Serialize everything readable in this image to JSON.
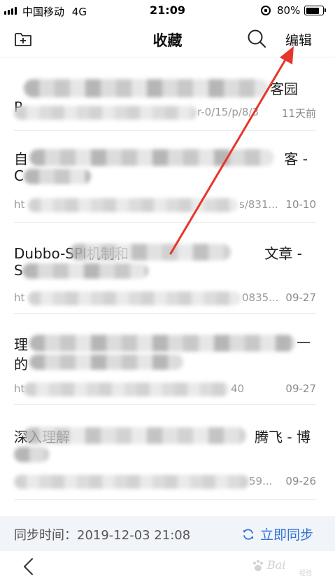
{
  "status_bar": {
    "carrier": "中国移动",
    "network": "4G",
    "time": "21:09",
    "battery": "80%",
    "battery_level": 0.8
  },
  "nav": {
    "title": "收藏",
    "edit_label": "编辑",
    "icons": [
      "add-folder-icon",
      "search-icon"
    ]
  },
  "favorites": [
    {
      "title": "P",
      "title_end": "客园",
      "url_start": "",
      "url_end": "r-0/15/p/8/3",
      "date": "11天前"
    },
    {
      "title_line1_start": "自",
      "title_line1_end": "客 -",
      "title_line2": "C",
      "url_start": "ht",
      "url_end": "s/831...",
      "date": "10-10"
    },
    {
      "title_line1_start": "Dubbo-SPI机制和",
      "title_line1_end": "文章 -",
      "title_line2": "S",
      "url_start": "ht",
      "url_end": "0835...",
      "date": "09-27"
    },
    {
      "title_line1_start": "理",
      "title_line1_end": "—",
      "title_line2": "的",
      "url_start": "ht",
      "url_end": "40",
      "date": "09-27"
    },
    {
      "title_line1_start": "深入理解",
      "title_line1_end": "腾飞 - 博",
      "title_line2": "",
      "url_start": "",
      "url_end": "59...",
      "date": "09-26"
    }
  ],
  "sync": {
    "label": "同步时间：2019-12-03 21:08",
    "button_label": "立即同步"
  },
  "watermark": {
    "text": "Bai",
    "sub": "经验"
  },
  "colors": {
    "accent": "#2f72d4",
    "annotation": "#e8352b",
    "sync_bg": "#f1f4f9"
  }
}
